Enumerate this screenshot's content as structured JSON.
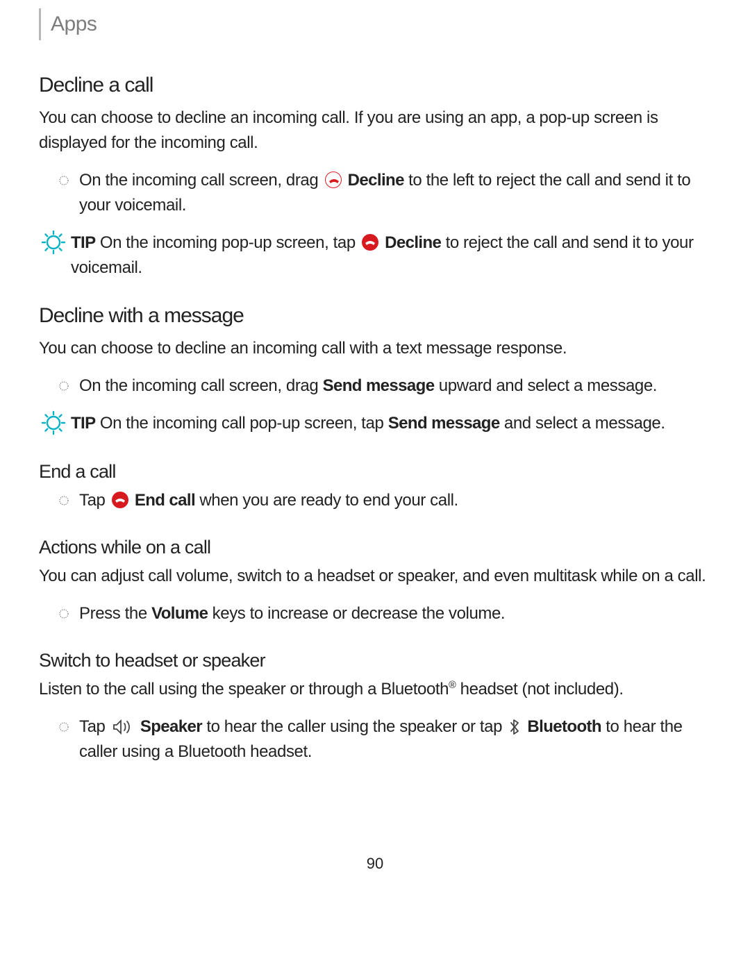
{
  "header": "Apps",
  "s1": {
    "h": "Decline a call",
    "p": "You can choose to decline an incoming call. If you are using an app, a pop-up screen is displayed for the incoming call.",
    "b1_a": "On the incoming call screen, drag ",
    "b1_b": " Decline",
    "b1_c": " to the left to reject the call and send it to your voicemail.",
    "tip_a": "TIP",
    "tip_b": "  On the incoming pop-up screen, tap ",
    "tip_c": " Decline",
    "tip_d": " to reject the call and send it to your voicemail."
  },
  "s2": {
    "h": "Decline with a message",
    "p": "You can choose to decline an incoming call with a text message response.",
    "b1_a": "On the incoming call screen, drag ",
    "b1_b": "Send message",
    "b1_c": " upward and select a message.",
    "tip_a": "TIP",
    "tip_b": "  On the incoming call pop-up screen, tap ",
    "tip_c": "Send message",
    "tip_d": " and select a message."
  },
  "s3": {
    "h": "End a call",
    "b1_a": "Tap ",
    "b1_b": " End call",
    "b1_c": " when you are ready to end your call."
  },
  "s4": {
    "h": "Actions while on a call",
    "p": "You can adjust call volume, switch to a headset or speaker, and even multitask while on a call.",
    "b1_a": "Press the ",
    "b1_b": "Volume",
    "b1_c": " keys to increase or decrease the volume."
  },
  "s5": {
    "h": "Switch to headset or speaker",
    "p_a": "Listen to the call using the speaker or through a Bluetooth",
    "p_sup": "®",
    "p_b": " headset (not included).",
    "b1_a": "Tap ",
    "b1_b": " Speaker",
    "b1_c": " to hear the caller using the speaker or tap ",
    "b1_d": " Bluetooth",
    "b1_e": " to hear the caller using a Bluetooth headset."
  },
  "page_number": "90"
}
